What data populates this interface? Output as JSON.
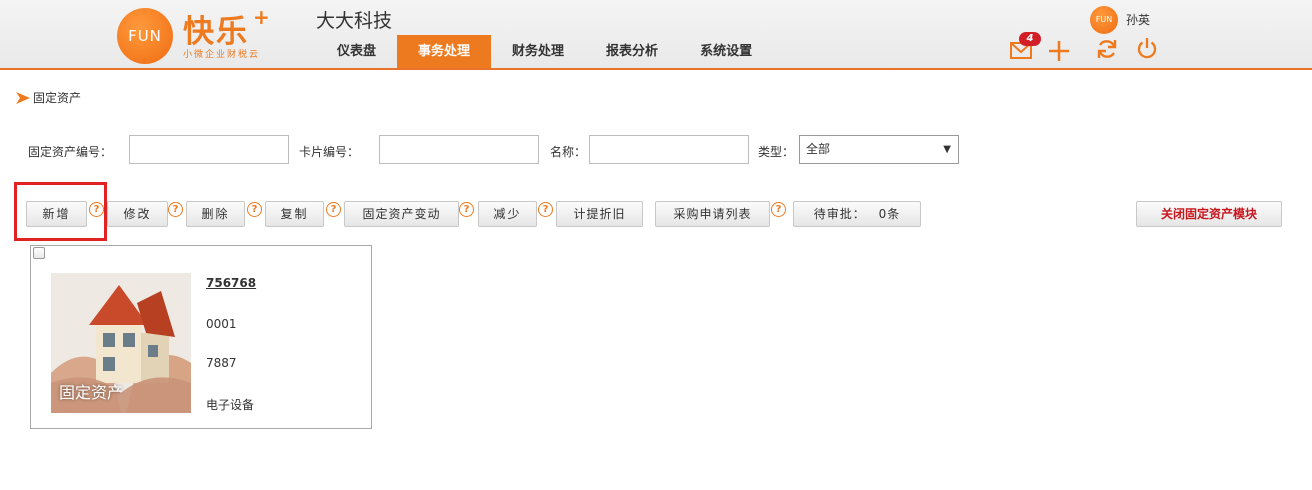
{
  "header": {
    "logo_text": "FUN",
    "logo_title": "快乐",
    "logo_plus": "+",
    "logo_sub": "小微企业财税云",
    "company_name": "大大科技",
    "nav": [
      {
        "label": "仪表盘",
        "active": false
      },
      {
        "label": "事务处理",
        "active": true
      },
      {
        "label": "财务处理",
        "active": false
      },
      {
        "label": "报表分析",
        "active": false
      },
      {
        "label": "系统设置",
        "active": false
      }
    ],
    "mail_count": "4",
    "user_avatar_text": "FUN",
    "user_name": "孙英"
  },
  "breadcrumb": {
    "label": "固定资产"
  },
  "search": {
    "asset_no_label": "固定资产编号：",
    "asset_no_value": "",
    "card_no_label": "卡片编号：",
    "card_no_value": "",
    "name_label": "名称：",
    "name_value": "",
    "type_label": "类型：",
    "type_value": "全部"
  },
  "toolbar": {
    "add": "新增",
    "edit": "修改",
    "delete": "删除",
    "copy": "复制",
    "change": "固定资产变动",
    "reduce": "减少",
    "depreciate": "计提折旧",
    "purchase_list": "采购申请列表",
    "pending_label": "待审批：",
    "pending_count": "0条",
    "close_module": "关闭固定资产模块",
    "help_glyph": "?"
  },
  "cards": [
    {
      "image_label": "固定资产",
      "code": "756768",
      "field1": "0001",
      "field2": "7887",
      "category": "电子设备"
    }
  ],
  "colors": {
    "accent": "#ee7a1f",
    "alert": "#d11f25",
    "highlight": "#e02222"
  }
}
